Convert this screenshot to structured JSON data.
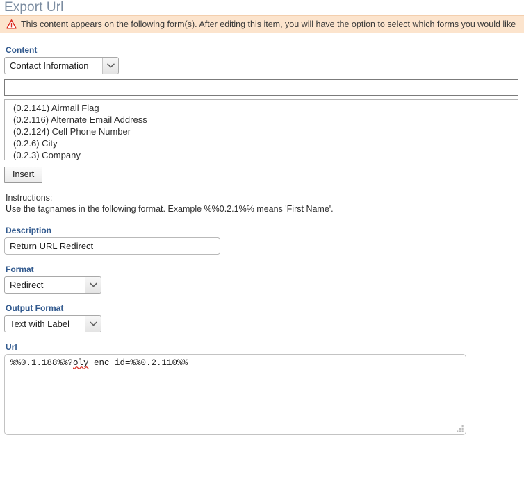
{
  "page": {
    "title": "Export Url"
  },
  "warning": {
    "icon": "warning-triangle-icon",
    "message": "This content appears on the following form(s). After editing this item, you will have the option to select which forms you would like"
  },
  "content_section": {
    "label": "Content",
    "selected": "Contact Information",
    "options": [
      "Contact Information"
    ],
    "search_value": "",
    "search_placeholder": "",
    "tags": [
      "(0.2.141) Airmail Flag",
      "(0.2.116) Alternate Email Address",
      "(0.2.124) Cell Phone Number",
      "(0.2.6) City",
      "(0.2.3) Company"
    ],
    "insert_label": "Insert"
  },
  "instructions": {
    "heading": "Instructions:",
    "body": "Use the tagnames in the following format. Example %%0.2.1%% means 'First Name'."
  },
  "description_section": {
    "label": "Description",
    "value": "Return URL Redirect"
  },
  "format_section": {
    "label": "Format",
    "selected": "Redirect",
    "options": [
      "Redirect"
    ]
  },
  "output_format_section": {
    "label": "Output Format",
    "selected": "Text with Label",
    "options": [
      "Text with Label"
    ]
  },
  "url_section": {
    "label": "Url",
    "value": "%%0.1.188%%?oly_enc_id=%%0.2.110%%",
    "misspelled_word": "oly",
    "text_before_misspelling": "%%0.1.188%%?",
    "text_after_misspelling": "_enc_id=%%0.2.110%%"
  },
  "colors": {
    "label_blue": "#31598e",
    "title_gray": "#7b8ca0",
    "warning_background": "#fce4cd",
    "warning_border": "#f3cfae",
    "warning_icon_red": "#d9261c",
    "spellcheck_red": "#d93025"
  }
}
